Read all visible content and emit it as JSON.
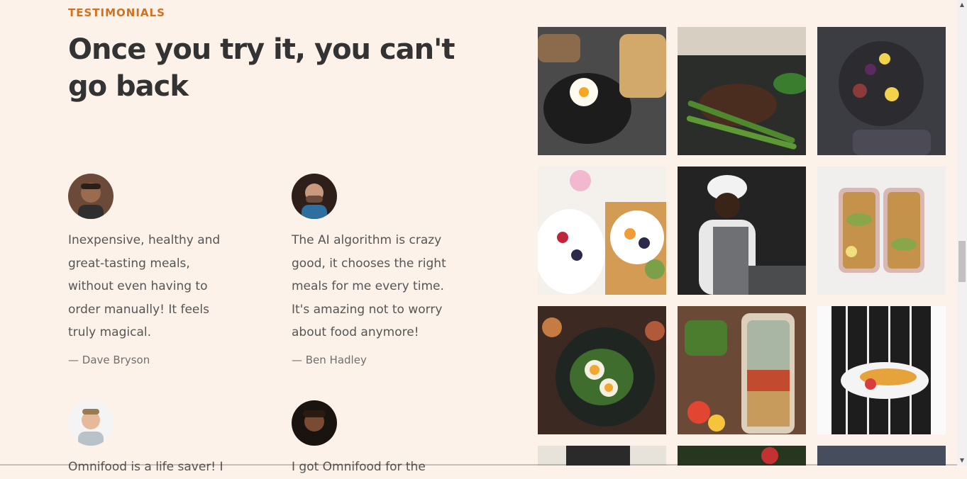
{
  "section": {
    "subheading": "TESTIMONIALS",
    "heading": "Once you try it, you can't go back"
  },
  "testimonials": [
    {
      "text": "Inexpensive, healthy and great-tasting meals, without even having to order manually! It feels truly magical.",
      "author": "— Dave Bryson"
    },
    {
      "text": "The AI algorithm is crazy good, it chooses the right meals for me every time. It's amazing not to worry about food anymore!",
      "author": "— Ben Hadley"
    },
    {
      "text": "Omnifood is a life saver! I",
      "author": ""
    },
    {
      "text": "I got Omnifood for the",
      "author": ""
    }
  ],
  "gallery": [
    {
      "name": "bibimbap-photo"
    },
    {
      "name": "steak-beans-photo"
    },
    {
      "name": "fruit-platter-photo"
    },
    {
      "name": "fruit-bowl-photo"
    },
    {
      "name": "chef-photo"
    },
    {
      "name": "meal-prep-photo"
    },
    {
      "name": "egg-salad-photo"
    },
    {
      "name": "salad-jar-photo"
    },
    {
      "name": "plated-dish-photo"
    }
  ],
  "colors": {
    "background": "#fdf2e9",
    "accent": "#cf711f",
    "heading": "#333333"
  }
}
